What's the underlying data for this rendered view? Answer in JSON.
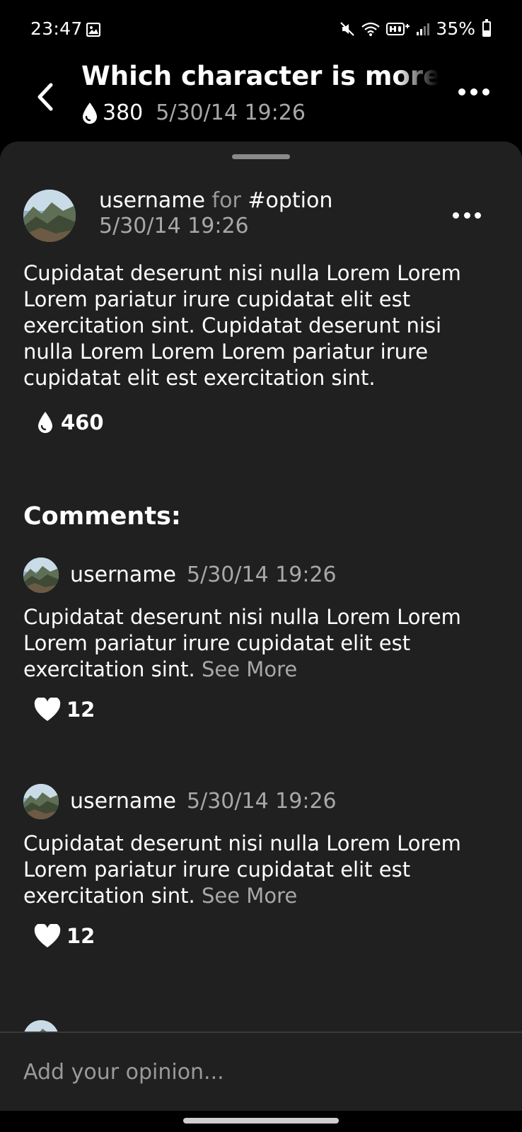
{
  "status_bar": {
    "time": "23:47",
    "battery": "35%",
    "battery_level": 0.35
  },
  "header": {
    "title": "Which character is more like",
    "votes": "380",
    "date": "5/30/14 19:26"
  },
  "post": {
    "username": "username",
    "for_word": "for",
    "option": "#option",
    "date": "5/30/14 19:26",
    "body": "Cupidatat deserunt nisi nulla Lorem Lorem Lorem pariatur irure cupidatat elit est exercitation sint. Cupidatat deserunt nisi nulla Lorem Lorem Lorem pariatur irure cupidatat elit est exercitation sint.",
    "votes": "460"
  },
  "comments_heading": "Comments:",
  "comments": [
    {
      "username": "username",
      "date": "5/30/14 19:26",
      "body": "Cupidatat deserunt nisi nulla Lorem Lorem Lorem pariatur irure cupidatat elit est exercitation sint.",
      "see_more": "See More",
      "likes": "12"
    },
    {
      "username": "username",
      "date": "5/30/14 19:26",
      "body": "Cupidatat deserunt nisi nulla Lorem Lorem Lorem pariatur irure cupidatat elit est exercitation sint.",
      "see_more": "See More",
      "likes": "12"
    }
  ],
  "input": {
    "placeholder": "Add your opinion..."
  },
  "icons": {
    "back": "chevron-left-icon",
    "more": "more-horizontal-icon",
    "vote": "drop-icon",
    "like": "heart-icon"
  },
  "colors": {
    "background": "#000000",
    "sheet": "#202020",
    "secondary_text": "#a8a8a8"
  }
}
